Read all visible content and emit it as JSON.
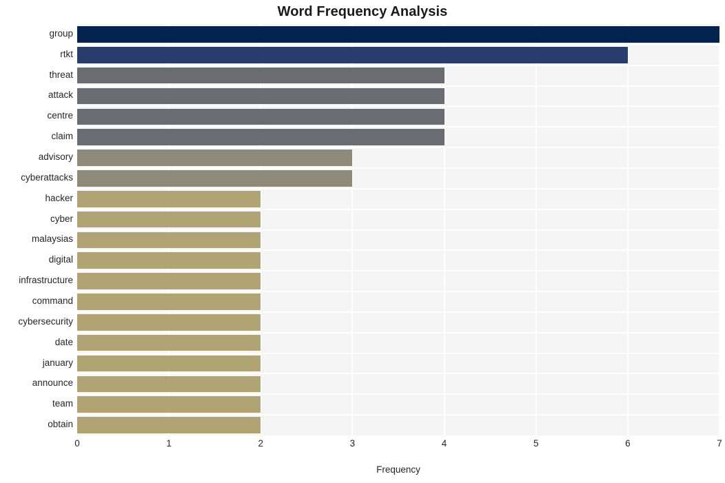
{
  "chart_data": {
    "type": "bar",
    "orientation": "horizontal",
    "title": "Word Frequency Analysis",
    "xlabel": "Frequency",
    "ylabel": "",
    "xlim": [
      0,
      7
    ],
    "xticks": [
      0,
      1,
      2,
      3,
      4,
      5,
      6,
      7
    ],
    "xtick_labels": [
      "0",
      "1",
      "2",
      "3",
      "4",
      "5",
      "6",
      "7"
    ],
    "grid": true,
    "grid_axis": "x",
    "legend": false,
    "categories": [
      "group",
      "rtkt",
      "threat",
      "attack",
      "centre",
      "claim",
      "advisory",
      "cyberattacks",
      "hacker",
      "cyber",
      "malaysias",
      "digital",
      "infrastructure",
      "command",
      "cybersecurity",
      "date",
      "january",
      "announce",
      "team",
      "obtain"
    ],
    "values": [
      7,
      6,
      4,
      4,
      4,
      4,
      3,
      3,
      2,
      2,
      2,
      2,
      2,
      2,
      2,
      2,
      2,
      2,
      2,
      2
    ],
    "bar_colors": [
      "#04234f",
      "#273e6c",
      "#6a6c72",
      "#6a6c72",
      "#6a6c72",
      "#6a6c72",
      "#8e8a7a",
      "#8e8a7a",
      "#b0a472",
      "#b0a472",
      "#b0a472",
      "#b0a472",
      "#b0a472",
      "#b0a472",
      "#b0a472",
      "#b0a472",
      "#b0a472",
      "#b0a472",
      "#b0a472",
      "#b0a472"
    ]
  },
  "style": {
    "plot_background": "#f5f5f6",
    "figure_background": "#ffffff",
    "gridline_color": "#ffffff",
    "text_color": "#262626",
    "title_color": "#1a1a1a"
  }
}
